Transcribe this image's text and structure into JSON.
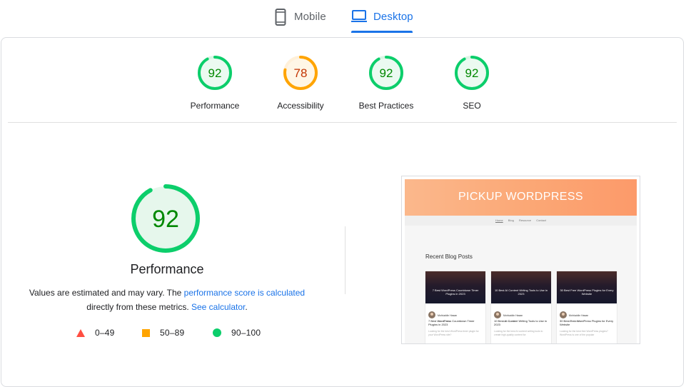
{
  "tabs": {
    "mobile": {
      "label": "Mobile",
      "icon": "smartphone-icon"
    },
    "desktop": {
      "label": "Desktop",
      "icon": "laptop-icon",
      "active": true
    }
  },
  "colors": {
    "pass": "#0cce6b",
    "pass_text": "#008800",
    "average": "#ffa400",
    "average_text": "#c33300",
    "fail": "#ff4e42",
    "link": "#1a73e8"
  },
  "categories": [
    {
      "label": "Performance",
      "score": "92",
      "score_value": 92,
      "rating": "pass"
    },
    {
      "label": "Accessibility",
      "score": "78",
      "score_value": 78,
      "rating": "average"
    },
    {
      "label": "Best Practices",
      "score": "92",
      "score_value": 92,
      "rating": "pass"
    },
    {
      "label": "SEO",
      "score": "92",
      "score_value": 92,
      "rating": "pass"
    }
  ],
  "performance": {
    "score": "92",
    "score_value": 92,
    "title": "Performance",
    "desc_prefix": "Values are estimated and may vary. The ",
    "desc_link1": "performance score is calculated",
    "desc_mid": " directly from these metrics. ",
    "desc_link2": "See calculator",
    "desc_suffix": "."
  },
  "legend": [
    {
      "shape": "triangle",
      "color": "#ff4e42",
      "range": "0–49"
    },
    {
      "shape": "square",
      "color": "#ffa400",
      "range": "50–89"
    },
    {
      "shape": "circle",
      "color": "#0cce6b",
      "range": "90–100"
    }
  ],
  "screenshot": {
    "site_title": "PICKUP WORDPRESS",
    "menu": [
      "Home",
      "Blog",
      "Resource",
      "Contact"
    ],
    "section_title": "Recent Blog Posts",
    "posts": [
      {
        "image_title": "7 Best WordPress Countdown Timer Plugins in 2023",
        "author": "Mohiuddin Hasan",
        "date": "Feb 27, 2023",
        "heading": "7 Best WordPress Countdown Timer Plugins in 2023",
        "excerpt": "Looking for the best WordPress timer plugin for your WordPress site?"
      },
      {
        "image_title": "10 Best AI Content Writing Tools to Use in 2023",
        "author": "Mohiuddin Hasan",
        "date": "Feb 22, 2023",
        "heading": "10 Best AI Content Writing Tools to Use in 2023",
        "excerpt": "Looking for the best AI content writing tools to create high-quality content for"
      },
      {
        "image_title": "30 Best Free WordPress Plugins for Every Website",
        "author": "Mohiuddin Hasan",
        "date": "Feb 7, 2023",
        "heading": "30 Best Free WordPress Plugins for Every Website",
        "excerpt": "Looking for the best free WordPress plugins? WordPress is one of the popular"
      }
    ]
  }
}
